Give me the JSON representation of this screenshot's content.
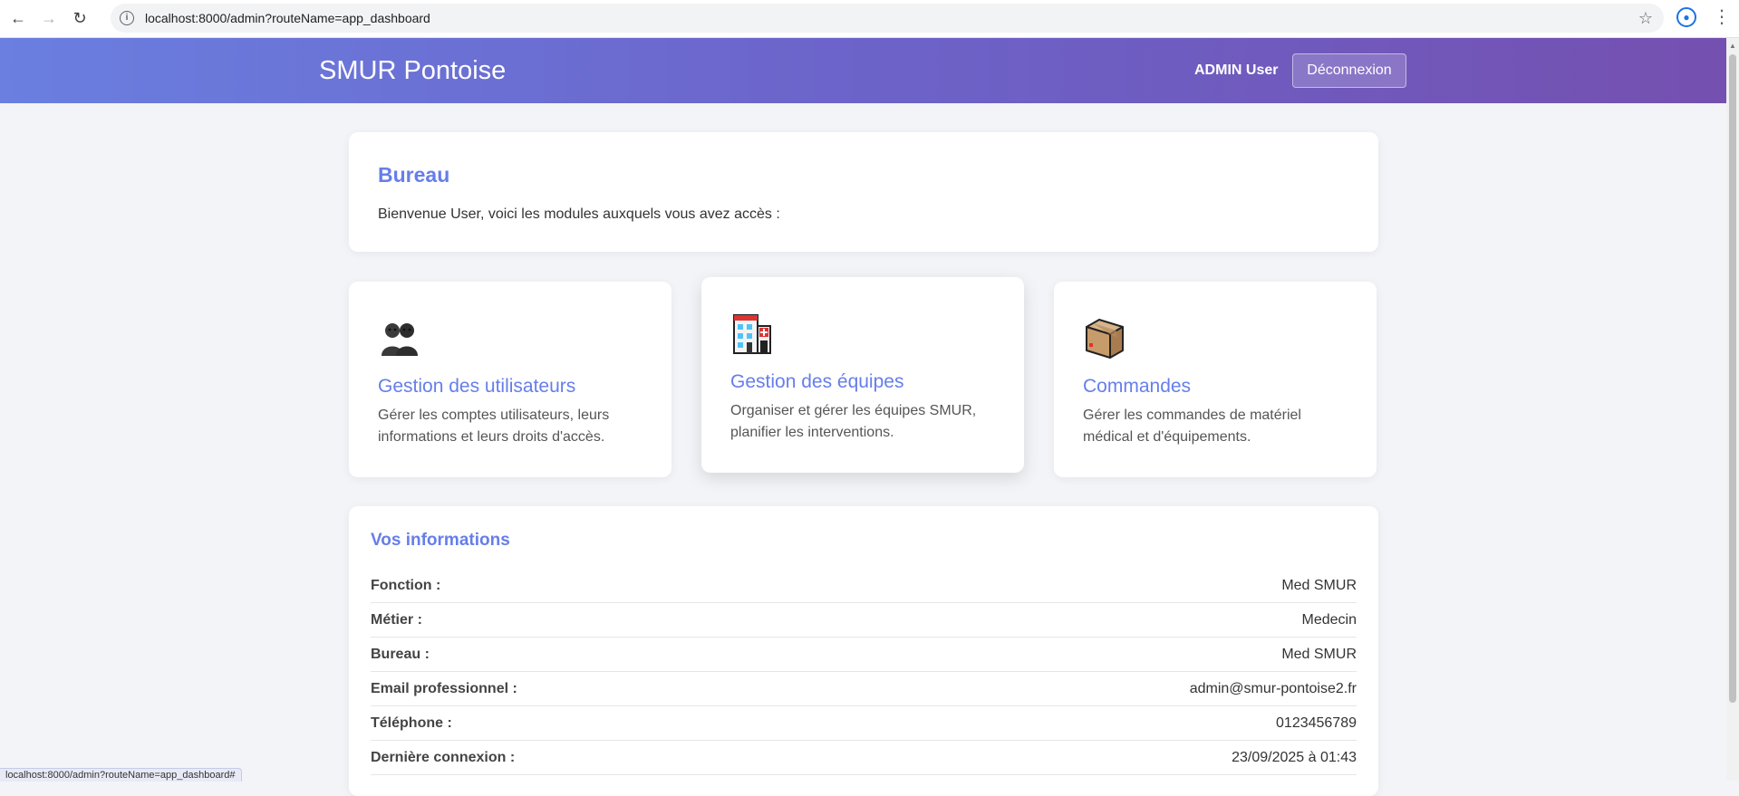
{
  "browser": {
    "url": "localhost:8000/admin?routeName=app_dashboard",
    "status_url": "localhost:8000/admin?routeName=app_dashboard#"
  },
  "header": {
    "brand": "SMUR Pontoise",
    "user_name": "ADMIN User",
    "logout_label": "Déconnexion"
  },
  "welcome": {
    "title": "Bureau",
    "text": "Bienvenue User, voici les modules auxquels vous avez accès :"
  },
  "modules": [
    {
      "icon": "users-icon",
      "title": "Gestion des utilisateurs",
      "description": "Gérer les comptes utilisateurs, leurs informations et leurs droits d'accès."
    },
    {
      "icon": "hospital-icon",
      "title": "Gestion des équipes",
      "description": "Organiser et gérer les équipes SMUR, planifier les interventions."
    },
    {
      "icon": "package-icon",
      "title": "Commandes",
      "description": "Gérer les commandes de matériel médical et d'équipements."
    }
  ],
  "info": {
    "title": "Vos informations",
    "rows": [
      {
        "label": "Fonction :",
        "value": "Med SMUR"
      },
      {
        "label": "Métier :",
        "value": "Medecin"
      },
      {
        "label": "Bureau :",
        "value": "Med SMUR"
      },
      {
        "label": "Email professionnel :",
        "value": "admin@smur-pontoise2.fr"
      },
      {
        "label": "Téléphone :",
        "value": "0123456789"
      },
      {
        "label": "Dernière connexion :",
        "value": "23/09/2025 à 01:43"
      }
    ]
  },
  "colors": {
    "accent": "#667eea",
    "header_start": "#6a7fe0",
    "header_end": "#7450b0"
  }
}
